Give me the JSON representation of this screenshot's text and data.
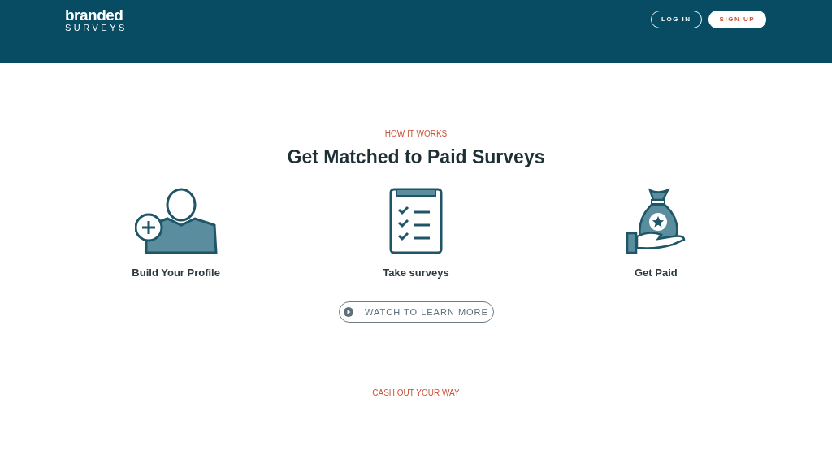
{
  "header": {
    "logo": {
      "line_1": "branded",
      "line_2": "SURVEYS"
    },
    "buttons": [
      {
        "kind": "outline",
        "label": "LOG IN"
      },
      {
        "kind": "solid",
        "label": "SIGN UP"
      }
    ]
  },
  "how_it_works": {
    "eyebrow": "HOW IT WORKS",
    "title": "Get Matched to Paid Surveys",
    "steps": [
      {
        "kind": "profile",
        "label": "Build Your Profile"
      },
      {
        "kind": "survey",
        "label": "Take surveys"
      },
      {
        "kind": "paid",
        "label": "Get Paid"
      }
    ],
    "video_button": "WATCH TO LEARN MORE"
  },
  "cash_out": {
    "eyebrow": "CASH OUT YOUR WAY"
  }
}
